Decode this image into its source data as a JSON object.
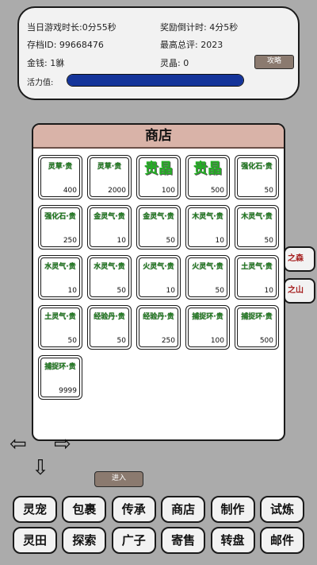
{
  "status": {
    "play_time": "当日游戏时长:0分55秒",
    "reward_countdown": "奖励倒计时: 4分5秒",
    "save_id": "存档ID: 99668476",
    "high_score": "最高总评: 2023",
    "money": "金钱: 1貅",
    "spirit_crystal": "灵晶: 0",
    "vitality_label": "活力值:",
    "vitality_fraction": 1.0,
    "strategy_button": "攻略"
  },
  "side_tabs": [
    "之森",
    "之山"
  ],
  "shop": {
    "title": "商店",
    "items": [
      {
        "name": "灵草·贵",
        "count": "400",
        "style": "small"
      },
      {
        "name": "灵草·贵",
        "count": "2000",
        "style": "small"
      },
      {
        "name": "贵晶",
        "count": "100",
        "style": "big"
      },
      {
        "name": "贵晶",
        "count": "500",
        "style": "big"
      },
      {
        "name": "强化石·贵",
        "count": "50",
        "style": "small"
      },
      {
        "name": "强化石·贵",
        "count": "250",
        "style": "small"
      },
      {
        "name": "金灵气·贵",
        "count": "10",
        "style": "small"
      },
      {
        "name": "金灵气·贵",
        "count": "50",
        "style": "small"
      },
      {
        "name": "木灵气·贵",
        "count": "10",
        "style": "small"
      },
      {
        "name": "木灵气·贵",
        "count": "50",
        "style": "small"
      },
      {
        "name": "水灵气·贵",
        "count": "10",
        "style": "small"
      },
      {
        "name": "水灵气·贵",
        "count": "50",
        "style": "small"
      },
      {
        "name": "火灵气·贵",
        "count": "10",
        "style": "small"
      },
      {
        "name": "火灵气·贵",
        "count": "50",
        "style": "small"
      },
      {
        "name": "土灵气·贵",
        "count": "10",
        "style": "small"
      },
      {
        "name": "土灵气·贵",
        "count": "50",
        "style": "small"
      },
      {
        "name": "经验丹·贵",
        "count": "50",
        "style": "small"
      },
      {
        "name": "经验丹·贵",
        "count": "250",
        "style": "small"
      },
      {
        "name": "捕捉环·贵",
        "count": "100",
        "style": "small"
      },
      {
        "name": "捕捉环·贵",
        "count": "500",
        "style": "small"
      },
      {
        "name": "捕捉环·贵",
        "count": "9999",
        "style": "small"
      }
    ]
  },
  "arrows": {
    "left": "⇦",
    "right": "⇨",
    "down": "⇩"
  },
  "enter_button": "进入",
  "nav_row1": [
    "灵宠",
    "包裹",
    "传承",
    "商店",
    "制作",
    "试炼"
  ],
  "nav_row2": [
    "灵田",
    "探索",
    "广子",
    "寄售",
    "转盘",
    "邮件"
  ],
  "colors": {
    "background": "#ababab",
    "panel": "#f2f2f2",
    "shop_header": "#d9b3a8",
    "item_text_green": "#1c7a1c",
    "vitality_blue": "#14349a",
    "button_brown": "#8b7a6f",
    "side_tab_red": "#a52020"
  }
}
